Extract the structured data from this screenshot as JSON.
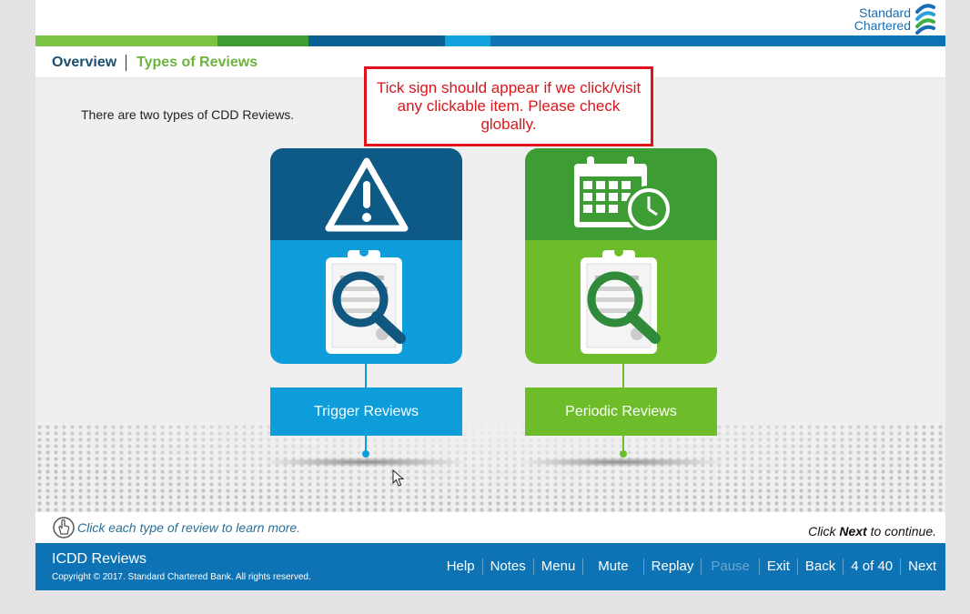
{
  "brand": {
    "line1": "Standard",
    "line2": "Chartered"
  },
  "colorbar": [
    "#7cc243",
    "#3f9c35",
    "#0a5f93",
    "#12a3df",
    "#0e73b5"
  ],
  "tabs": {
    "overview": "Overview",
    "types": "Types of Reviews"
  },
  "intro": "There are two types of CDD Reviews.",
  "note": "Tick sign should appear if we click/visit any clickable item. Please check globally.",
  "cards": {
    "trigger": {
      "label": "Trigger Reviews",
      "top_icon": "warning-icon",
      "bottom_icon": "clipboard-magnifier-icon"
    },
    "periodic": {
      "label": "Periodic Reviews",
      "top_icon": "calendar-clock-icon",
      "bottom_icon": "clipboard-magnifier-icon"
    }
  },
  "instruction": "Click each type of review to learn more.",
  "continue": {
    "prefix": "Click ",
    "bold": "Next",
    "suffix": " to continue."
  },
  "footer": {
    "title": "ICDD Reviews",
    "copyright": "Copyright © 2017. Standard Chartered Bank. All rights reserved.",
    "nav": {
      "help": "Help",
      "notes": "Notes",
      "menu": "Menu",
      "mute": "Mute",
      "replay": "Replay",
      "pause": "Pause",
      "exit": "Exit",
      "back": "Back",
      "page": "4 of 40",
      "next": "Next"
    }
  },
  "colors": {
    "brand_blue": "#0e73b5",
    "accent_green": "#6cb33f",
    "note_red": "#e0131c"
  }
}
